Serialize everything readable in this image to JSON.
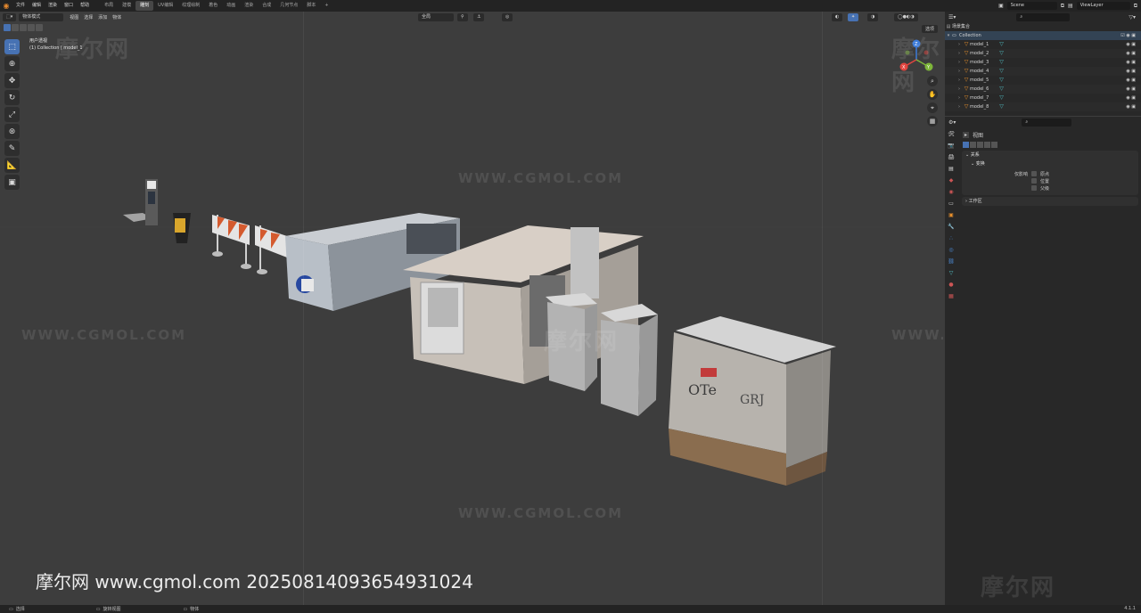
{
  "topbar": {
    "menu": [
      "文件",
      "编辑",
      "渲染",
      "窗口",
      "帮助"
    ],
    "workspaces": [
      "布局",
      "建模",
      "雕刻",
      "UV编辑",
      "纹理绘制",
      "着色",
      "动画",
      "渲染",
      "合成",
      "几何节点",
      "脚本",
      "+"
    ],
    "active_workspace_index": 2,
    "scene": "Scene",
    "view_layer": "ViewLayer"
  },
  "viewport": {
    "mode": "物体模式",
    "menu": [
      "视图",
      "选择",
      "添加",
      "物体"
    ],
    "transform_orient": "全局",
    "options_label": "选项",
    "view_name": "用户透视",
    "active_object": "(1) Collection | model_1",
    "tools": [
      "select-box",
      "cursor",
      "move",
      "rotate",
      "scale",
      "transform",
      "annotate",
      "measure",
      "add-cube"
    ],
    "gizmo_axes": [
      "X",
      "Y",
      "Z"
    ]
  },
  "watermarks": {
    "url": "WWW.CGMOL.COM",
    "logo": "摩尔网"
  },
  "footer_url": "摩尔网 www.cgmol.com 20250814093654931024",
  "outliner": {
    "title": "场景集合",
    "collection": "Collection",
    "items": [
      "model_1",
      "model_2",
      "model_3",
      "model_4",
      "model_5",
      "model_6",
      "model_7",
      "model_8"
    ]
  },
  "properties": {
    "context": "视图",
    "panel_relations": "关系",
    "panel_transform": "变换",
    "affect_only_label": "仅影响",
    "affect_options": [
      "原点",
      "位置",
      "父级"
    ],
    "panel_workspace": "工作区"
  },
  "statusbar": {
    "select": "选择",
    "rotate": "旋转视图",
    "object": "物体",
    "version": "4.1.1"
  },
  "colors": {
    "accent": "#4772b3",
    "viewport_bg": "#3d3d3d",
    "panel_bg": "#282828",
    "mesh_icon": "#e8902c",
    "axis_x": "#e0453f",
    "axis_y": "#7eb63a",
    "axis_z": "#3d7bd8"
  }
}
